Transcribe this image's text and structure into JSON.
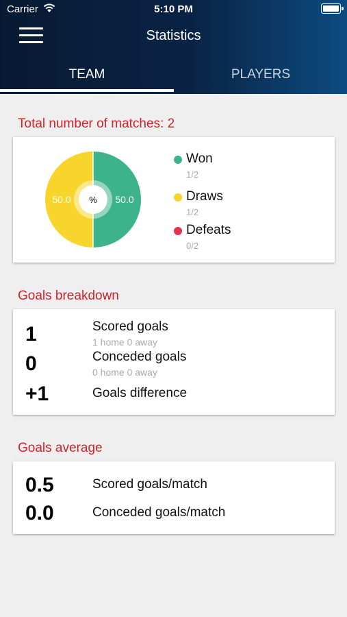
{
  "status_bar": {
    "carrier": "Carrier",
    "time": "5:10 PM"
  },
  "header": {
    "title": "Statistics"
  },
  "tabs": [
    {
      "label": "TEAM",
      "active": true
    },
    {
      "label": "PLAYERS",
      "active": false
    }
  ],
  "matches": {
    "title": "Total number of matches: 2",
    "center_label": "%",
    "legend": [
      {
        "name": "Won",
        "fraction": "1/2",
        "color": "#3db38c"
      },
      {
        "name": "Draws",
        "fraction": "1/2",
        "color": "#f7d52d"
      },
      {
        "name": "Defeats",
        "fraction": "0/2",
        "color": "#e0344e"
      }
    ]
  },
  "chart_data": {
    "type": "pie",
    "categories": [
      "Won",
      "Draws",
      "Defeats"
    ],
    "values": [
      50.0,
      50.0,
      0.0
    ],
    "labels": [
      "50.0",
      "50.0"
    ],
    "colors": [
      "#3db38c",
      "#f7d52d",
      "#e0344e"
    ]
  },
  "goals_breakdown": {
    "title": "Goals breakdown",
    "rows": [
      {
        "value": "1",
        "label": "Scored goals",
        "sub": "1 home  0 away"
      },
      {
        "value": "0",
        "label": "Conceded goals",
        "sub": "0 home  0 away"
      },
      {
        "value": "+1",
        "label": "Goals difference"
      }
    ]
  },
  "goals_average": {
    "title": "Goals average",
    "rows": [
      {
        "value": "0.5",
        "label": "Scored goals/match"
      },
      {
        "value": "0.0",
        "label": "Conceded goals/match"
      }
    ]
  }
}
